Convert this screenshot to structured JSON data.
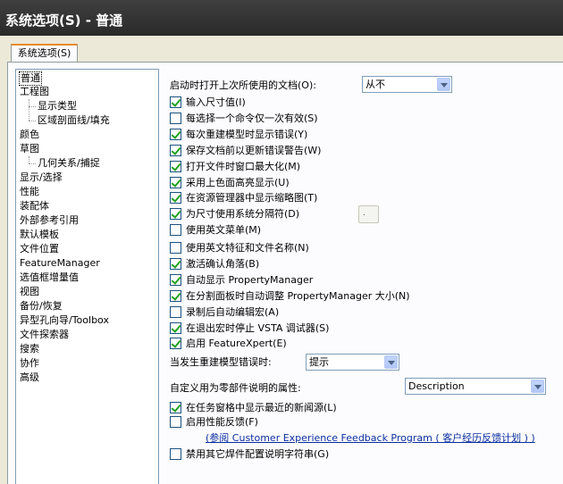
{
  "window": {
    "title": "系统选项(S) - 普通"
  },
  "tab": {
    "label": "系统选项(S)"
  },
  "tree": {
    "items": [
      "普通",
      "工程图",
      "显示类型",
      "区域剖面线/填充",
      "颜色",
      "草图",
      "几何关系/捕捉",
      "显示/选择",
      "性能",
      "装配体",
      "外部参考引用",
      "默认模板",
      "文件位置",
      "FeatureManager",
      "选值框增量值",
      "视图",
      "备份/恢复",
      "异型孔向导/Toolbox",
      "文件探索器",
      "搜索",
      "协作",
      "高级"
    ]
  },
  "options": {
    "startup_label": "启动时打开上次所使用的文档(O):",
    "startup_value": "从不",
    "checks": [
      {
        "label": "输入尺寸值(I)",
        "checked": true
      },
      {
        "label": "每选择一个命令仅一次有效(S)",
        "checked": false
      },
      {
        "label": "每次重建模型时显示错误(Y)",
        "checked": true
      },
      {
        "label": "保存文档前以更新错误警告(W)",
        "checked": true
      },
      {
        "label": "打开文件时窗口最大化(M)",
        "checked": true
      },
      {
        "label": "采用上色面高亮显示(U)",
        "checked": true
      },
      {
        "label": "在资源管理器中显示缩略图(T)",
        "checked": true
      },
      {
        "label": "为尺寸使用系统分隔符(D)",
        "checked": true
      },
      {
        "label": "使用英文菜单(M)",
        "checked": false
      },
      {
        "label": "使用英文特征和文件名称(N)",
        "checked": false
      },
      {
        "label": "激活确认角落(B)",
        "checked": true
      },
      {
        "label": "自动显示 PropertyManager",
        "checked": true
      },
      {
        "label": "在分割面板时自动调整 PropertyManager 大小(N)",
        "checked": true
      },
      {
        "label": "录制后自动编辑宏(A)",
        "checked": false
      },
      {
        "label": "在退出宏时停止 VSTA 调试器(S)",
        "checked": true
      },
      {
        "label": "启用 FeatureXpert(E)",
        "checked": true
      }
    ],
    "rebuild_label": "当发生重建模型错误时:",
    "rebuild_value": "提示",
    "custom_prop_label": "自定义用为零部件说明的属性:",
    "custom_prop_value": "Description",
    "news_label": "在任务窗格中显示最近的新闻源(L)",
    "news_checked": true,
    "feedback_label": "启用性能反馈(F)",
    "feedback_checked": false,
    "feedback_link": "(参阅 Customer Experience Feedback Program ( 客户经历反馈计划 ) )",
    "disable_label": "禁用其它焊件配置说明字符串(G)",
    "disable_checked": false
  }
}
